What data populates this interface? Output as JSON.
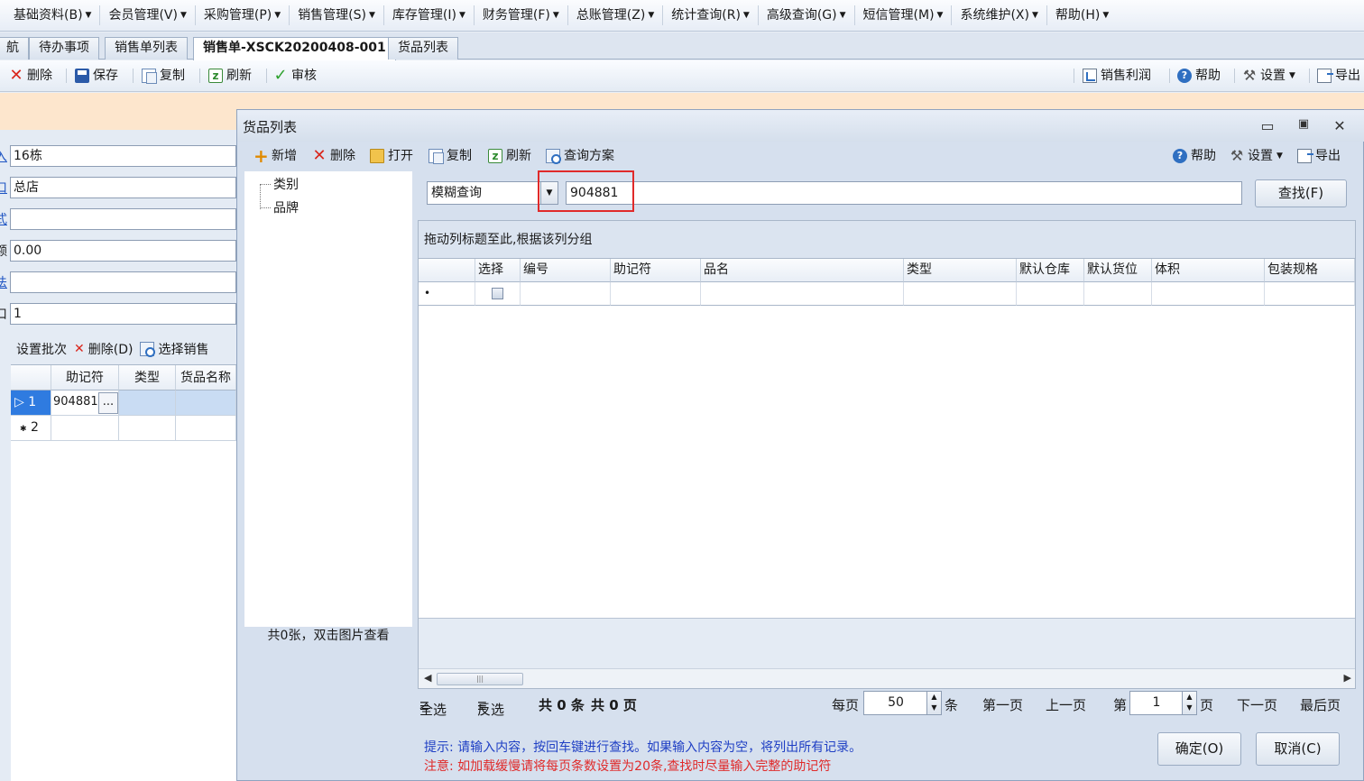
{
  "menubar": {
    "items": [
      "基础资料(B)",
      "会员管理(V)",
      "采购管理(P)",
      "销售管理(S)",
      "库存管理(I)",
      "财务管理(F)",
      "总账管理(Z)",
      "统计查询(R)",
      "高级查询(G)",
      "短信管理(M)",
      "系统维护(X)",
      "帮助(H)"
    ]
  },
  "tabs": {
    "items": [
      "航",
      "待办事项",
      "销售单列表",
      "销售单-XSCK20200408-001",
      "货品列表"
    ],
    "active_index": 3
  },
  "main_toolbar": {
    "delete": "删除",
    "save": "保存",
    "copy": "复制",
    "refresh": "刷新",
    "audit": "审核",
    "profit": "销售利润",
    "help": "帮助",
    "settings": "设置",
    "export": "导出"
  },
  "form": {
    "rows": [
      {
        "label": "入",
        "value": "16栋"
      },
      {
        "label": "口",
        "value": "总店"
      },
      {
        "label": "式",
        "value": ""
      },
      {
        "label": "额",
        "value": "0.00"
      },
      {
        "label": "法",
        "value": ""
      },
      {
        "label": "口",
        "value": "1"
      }
    ],
    "detail_toolbar": {
      "set_batch": "设置批次",
      "delete": "删除(D)",
      "select_sales": "选择销售"
    },
    "grid": {
      "headers": [
        "",
        "助记符",
        "类型",
        "货品名称"
      ],
      "rows": [
        {
          "num": "1",
          "code": "904881",
          "type": "",
          "name": ""
        },
        {
          "num": "2",
          "code": "",
          "type": "",
          "name": ""
        }
      ],
      "ellipsis": "..."
    }
  },
  "dialog": {
    "title": "货品列表",
    "toolbar": {
      "add": "新增",
      "delete": "删除",
      "open": "打开",
      "copy": "复制",
      "refresh": "刷新",
      "query_plan": "查询方案",
      "help": "帮助",
      "settings": "设置",
      "export": "导出"
    },
    "tree": [
      "类别",
      "品牌"
    ],
    "image_caption": "共0张，双击图片查看",
    "search": {
      "mode": "模糊查询",
      "value": "904881",
      "find_button": "查找(F)"
    },
    "grid": {
      "group_hint": "拖动列标题至此,根据该列分组",
      "columns": [
        "",
        "选择",
        "编号",
        "助记符",
        "品名",
        "类型",
        "默认仓库",
        "默认货位",
        "体积",
        "包装规格"
      ],
      "new_row_marker": "•"
    },
    "pager": {
      "select_all": "全选",
      "invert": "反选",
      "total_records": "共 0 条",
      "total_pages": "共 0 页",
      "per_page_label": "每页",
      "per_page": "50",
      "per_page_unit": "条",
      "first": "第一页",
      "prev": "上一页",
      "page_label": "第",
      "page": "1",
      "page_unit": "页",
      "next": "下一页",
      "last": "最后页"
    },
    "hint_line1": "提示: 请输入内容，按回车键进行查找。如果输入内容为空，将列出所有记录。",
    "hint_line2": "注意: 如加载缓慢请将每页条数设置为20条,查找时尽量输入完整的助记符",
    "ok_button": "确定(O)",
    "cancel_button": "取消(C)"
  },
  "colors": {
    "accent": "#2f6fc1",
    "highlight_box": "#e02a2a",
    "warning_text": "#e02a2a",
    "hint_text": "#1f3fc4",
    "orange_band": "#fde6cd"
  }
}
